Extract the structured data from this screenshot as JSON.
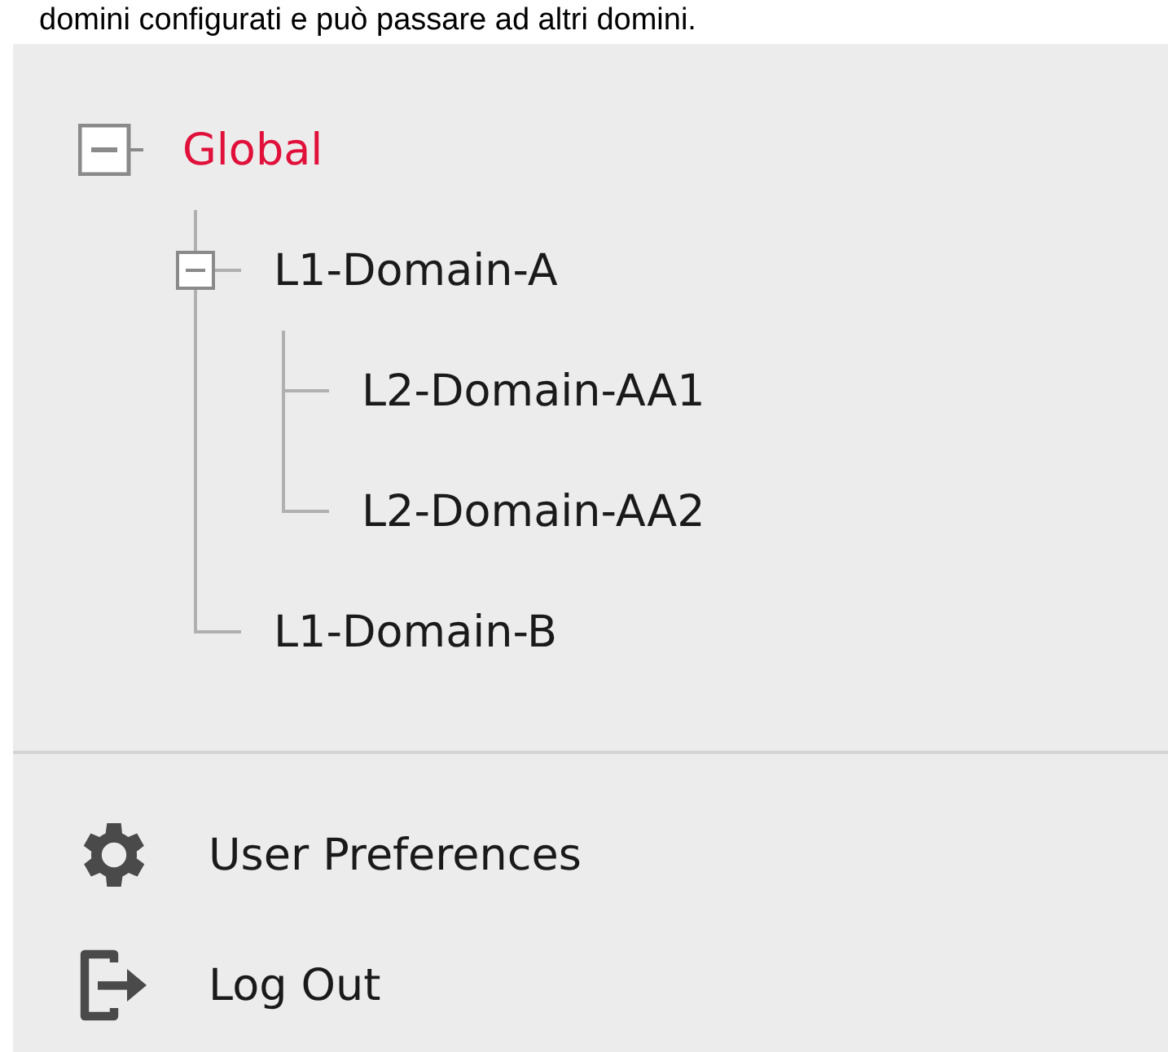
{
  "intro_text": "domini configurati e può passare ad altri domini.",
  "tree": [
    {
      "label": "Global",
      "selected": true,
      "expanded": true,
      "children": [
        {
          "label": "L1-Domain-A",
          "selected": false,
          "expanded": true,
          "children": [
            {
              "label": "L2-Domain-AA1",
              "selected": false
            },
            {
              "label": "L2-Domain-AA2",
              "selected": false
            }
          ]
        },
        {
          "label": "L1-Domain-B",
          "selected": false
        }
      ]
    }
  ],
  "menu": [
    {
      "kind": "preferences",
      "label": "User Preferences"
    },
    {
      "kind": "logout",
      "label": "Log Out"
    }
  ]
}
